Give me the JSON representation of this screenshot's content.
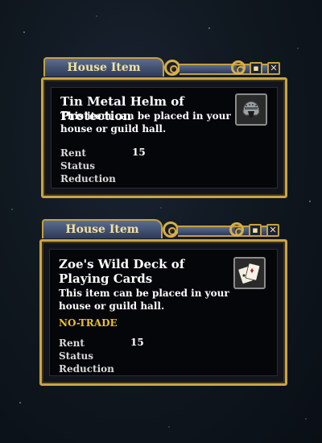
{
  "windows": [
    {
      "header": "House Item",
      "title": "Tin Metal Helm of Protection",
      "description": "This item can be placed in your house or guild hall.",
      "rent_status_label": "Rent Status Reduction",
      "rent_status_value": "15",
      "icon": "helm-icon"
    },
    {
      "header": "House Item",
      "title": "Zoe's Wild Deck of Playing Cards",
      "description": "This item can be placed in your house or guild hall.",
      "flag": "NO-TRADE",
      "rent_status_label": "Rent Status Reduction",
      "rent_status_value": "15",
      "icon": "playing-cards-icon"
    }
  ],
  "controls": {
    "minimize_glyph": "▪",
    "close_glyph": "✕"
  },
  "colors": {
    "frame_gold": "#c9a447",
    "header_text": "#f3e0a0",
    "no_trade": "#e9c22a",
    "panel_bg": "#05060a"
  }
}
